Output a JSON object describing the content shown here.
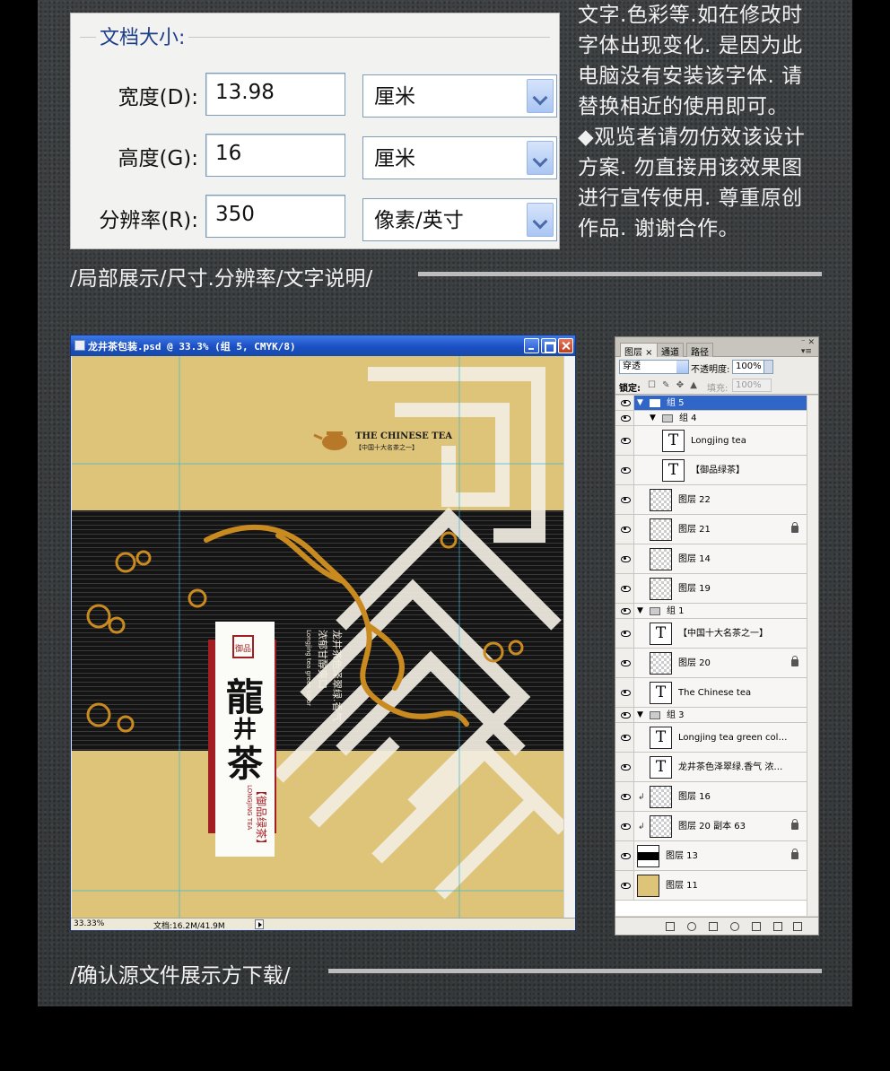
{
  "doc_size_dialog": {
    "legend": "文档大小:",
    "rows": [
      {
        "label": "宽度(D):",
        "value": "13.98",
        "unit": "厘米"
      },
      {
        "label": "高度(G):",
        "value": "16",
        "unit": "厘米"
      },
      {
        "label": "分辨率(R):",
        "value": "350",
        "unit": "像素/英寸"
      }
    ]
  },
  "notice": {
    "lines": [
      "文字.色彩等.如在修改时",
      "字体出现变化. 是因为此",
      "电脑没有安装该字体. 请",
      "替换相近的使用即可。",
      "◆观览者请勿仿效该设计",
      "方案. 勿直接用该效果图",
      "进行宣传使用. 尊重原创",
      "作品. 谢谢合作。"
    ]
  },
  "captions": {
    "top": "/局部展示/尺寸.分辨率/文字说明/",
    "bottom": "/确认源文件展示方下载/"
  },
  "ps_window": {
    "title": "龙井茶包装.psd @ 33.3% (组 5, CMYK/8)",
    "zoom": "33.33%",
    "doc_info": "文档:16.2M/41.9M",
    "design": {
      "brand_en": "THE CHINESE TEA",
      "brand_cn": "【中国十大名茶之一】",
      "seal": "御品",
      "title_char1": "龍",
      "title_char2": "井",
      "title_char3": "茶",
      "subtitle": "【御品绿茶】",
      "subtitle_en": "LONGJING TEA",
      "vertical_text_1": "龙井茶色泽翠绿.香气",
      "vertical_text_2": "浓郁甘醇爽口",
      "vertical_text_3": "Longjing tea green color"
    },
    "colors": {
      "canvas": "#ddc479",
      "band": "#111111",
      "dragon": "#c98a1f",
      "red": "#a31e22"
    }
  },
  "layers_panel": {
    "tabs": [
      "图层 ×",
      "通道",
      "路径"
    ],
    "blend_mode": "穿透",
    "opacity_label": "不透明度:",
    "opacity": "100%",
    "lock_label": "锁定:",
    "lock_icons": "☐ ✎ ✥ ▲",
    "fill_label": "填充:",
    "fill": "100%",
    "layers": [
      {
        "kind": "group",
        "name": "组 5",
        "indent": 0,
        "selected": true,
        "open": true
      },
      {
        "kind": "group",
        "name": "组 4",
        "indent": 1,
        "open": true
      },
      {
        "kind": "text",
        "name": "Longjing tea",
        "indent": 2
      },
      {
        "kind": "text",
        "name": "【御品绿茶】",
        "indent": 2
      },
      {
        "kind": "pixel",
        "name": "图层 22",
        "indent": 1
      },
      {
        "kind": "pixel",
        "name": "图层 21",
        "indent": 1,
        "locked": true
      },
      {
        "kind": "pixel",
        "name": "图层 14",
        "indent": 1
      },
      {
        "kind": "pixel",
        "name": "图层 19",
        "indent": 1
      },
      {
        "kind": "group",
        "name": "组 1",
        "indent": 0,
        "open": true
      },
      {
        "kind": "text",
        "name": "【中国十大名茶之一】",
        "indent": 1
      },
      {
        "kind": "pixel",
        "name": "图层 20",
        "indent": 1,
        "locked": true
      },
      {
        "kind": "text",
        "name": "The Chinese tea",
        "indent": 1
      },
      {
        "kind": "group",
        "name": "组 3",
        "indent": 0,
        "open": true
      },
      {
        "kind": "text",
        "name": "Longjing tea green color, rich ...",
        "indent": 1
      },
      {
        "kind": "text",
        "name": "龙井茶色泽翠绿.香气 浓郁....",
        "indent": 1
      },
      {
        "kind": "pixel",
        "name": "图层 16",
        "indent": 1,
        "clip": true
      },
      {
        "kind": "pixel",
        "name": "图层 20 副本 63",
        "indent": 1,
        "clip": true,
        "locked": true
      },
      {
        "kind": "blackbar",
        "name": "图层 13",
        "indent": 0,
        "locked": true
      },
      {
        "kind": "yellow",
        "name": "图层 11",
        "indent": 0
      }
    ]
  }
}
